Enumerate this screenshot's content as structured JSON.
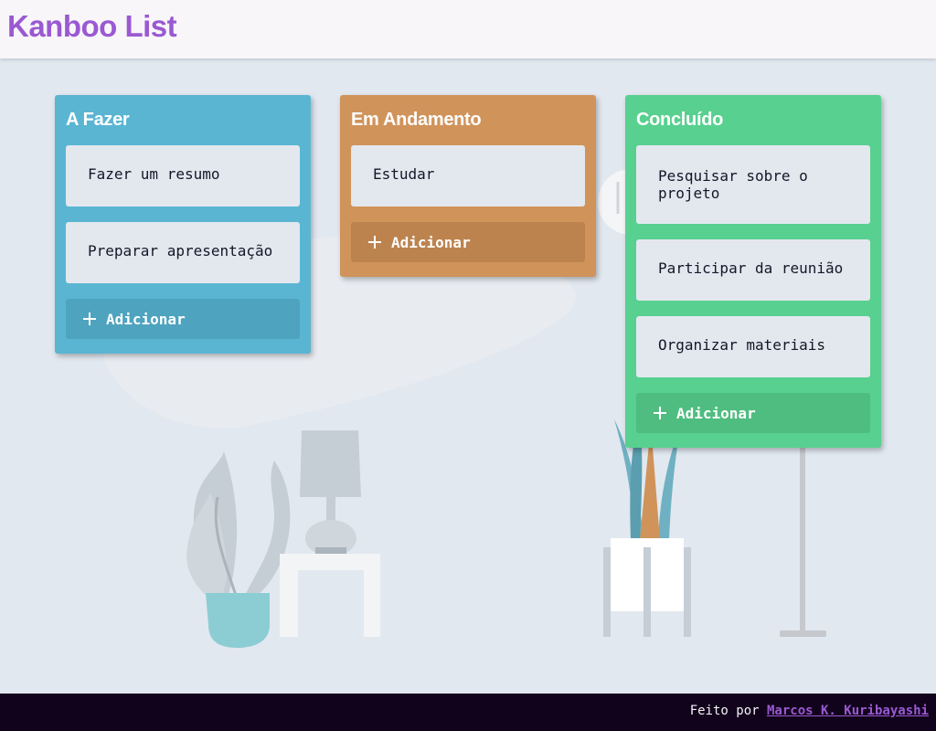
{
  "app": {
    "title": "Kanboo List"
  },
  "colors": {
    "brand": "#9a59d1",
    "todo": "#5ab5d3",
    "todo_button": "#4ea3bf",
    "doing": "#d0935a",
    "doing_button": "#bd834f",
    "done": "#58d08f",
    "done_button": "#4fbd80",
    "card": "#e3e8ef"
  },
  "columns": [
    {
      "title": "A Fazer",
      "cards": [
        "Fazer um resumo",
        "Preparar apresentação"
      ],
      "add_label": "Adicionar"
    },
    {
      "title": "Em Andamento",
      "cards": [
        "Estudar"
      ],
      "add_label": "Adicionar"
    },
    {
      "title": "Concluído",
      "cards": [
        "Pesquisar sobre o projeto",
        "Participar da reunião",
        "Organizar materiais"
      ],
      "add_label": "Adicionar"
    }
  ],
  "footer": {
    "prefix": "Feito por",
    "author": "Marcos K. Kuribayashi"
  },
  "icons": {
    "add": "plus-icon"
  }
}
